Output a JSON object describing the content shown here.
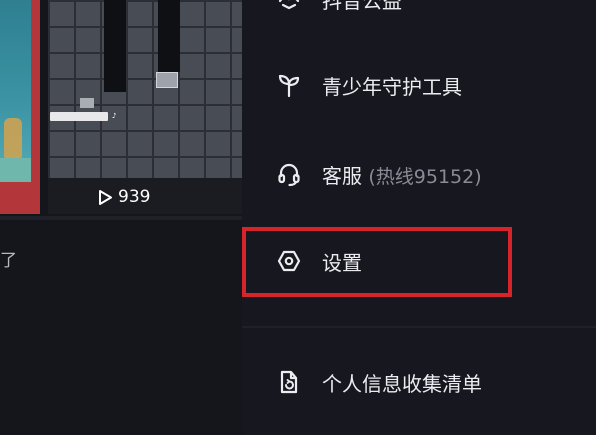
{
  "feed": {
    "play_count": "939",
    "caption_fragment": "了"
  },
  "menu": {
    "items": [
      {
        "label": "抖音公益",
        "icon": "charity-icon"
      },
      {
        "label": "青少年守护工具",
        "icon": "sprout-icon"
      },
      {
        "label": "客服",
        "sub": "(热线95152)",
        "icon": "headset-icon"
      },
      {
        "label": "设置",
        "icon": "hexagon-settings-icon"
      },
      {
        "label": "个人信息收集清单",
        "icon": "document-refresh-icon"
      }
    ]
  },
  "colors": {
    "background": "#17171f",
    "menu_text": "#ececf0",
    "sub_text": "#8a8b96",
    "highlight": "#d6242b"
  }
}
